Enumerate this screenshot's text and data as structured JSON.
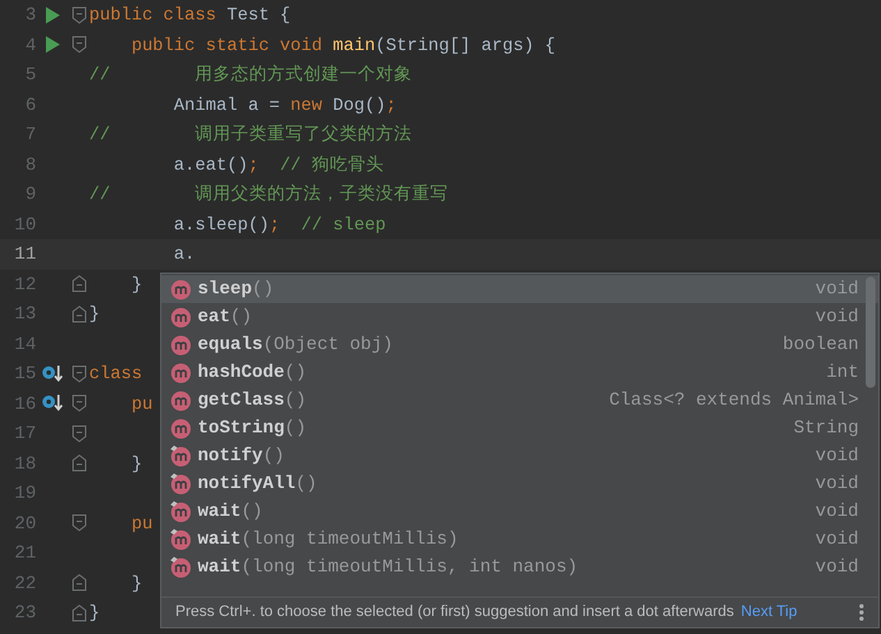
{
  "editor": {
    "lines": [
      {
        "number": "3",
        "runnable": true,
        "overridden": false,
        "fold_start": true,
        "fold_end": false,
        "current": false,
        "tokens": [
          {
            "kind": "keyword",
            "text": "public class "
          },
          {
            "kind": "plain",
            "text": "Test {"
          }
        ]
      },
      {
        "number": "4",
        "runnable": true,
        "overridden": false,
        "fold_start": true,
        "fold_end": false,
        "current": false,
        "tokens": [
          {
            "kind": "keyword",
            "text": "    public static void "
          },
          {
            "kind": "method",
            "text": "main"
          },
          {
            "kind": "plain",
            "text": "(String[] args) {"
          }
        ]
      },
      {
        "number": "5",
        "runnable": false,
        "overridden": false,
        "fold_start": false,
        "fold_end": false,
        "current": false,
        "tokens": [
          {
            "kind": "comment",
            "text": "//        用多态的方式创建一个对象"
          }
        ]
      },
      {
        "number": "6",
        "runnable": false,
        "overridden": false,
        "fold_start": false,
        "fold_end": false,
        "current": false,
        "tokens": [
          {
            "kind": "plain",
            "text": "        Animal a = "
          },
          {
            "kind": "keyword",
            "text": "new "
          },
          {
            "kind": "plain",
            "text": "Dog()"
          },
          {
            "kind": "keyword",
            "text": ";"
          }
        ]
      },
      {
        "number": "7",
        "runnable": false,
        "overridden": false,
        "fold_start": false,
        "fold_end": false,
        "current": false,
        "tokens": [
          {
            "kind": "comment",
            "text": "//        调用子类重写了父类的方法"
          }
        ]
      },
      {
        "number": "8",
        "runnable": false,
        "overridden": false,
        "fold_start": false,
        "fold_end": false,
        "current": false,
        "tokens": [
          {
            "kind": "plain",
            "text": "        a.eat()"
          },
          {
            "kind": "keyword",
            "text": ";  "
          },
          {
            "kind": "comment",
            "text": "// 狗吃骨头"
          }
        ]
      },
      {
        "number": "9",
        "runnable": false,
        "overridden": false,
        "fold_start": false,
        "fold_end": false,
        "current": false,
        "tokens": [
          {
            "kind": "comment",
            "text": "//        调用父类的方法，子类没有重写"
          }
        ]
      },
      {
        "number": "10",
        "runnable": false,
        "overridden": false,
        "fold_start": false,
        "fold_end": false,
        "current": false,
        "tokens": [
          {
            "kind": "plain",
            "text": "        a.sleep()"
          },
          {
            "kind": "keyword",
            "text": ";  "
          },
          {
            "kind": "comment",
            "text": "// sleep"
          }
        ]
      },
      {
        "number": "11",
        "runnable": false,
        "overridden": false,
        "fold_start": false,
        "fold_end": false,
        "current": true,
        "tokens": [
          {
            "kind": "plain",
            "text": "        a."
          }
        ]
      },
      {
        "number": "12",
        "runnable": false,
        "overridden": false,
        "fold_start": false,
        "fold_end": true,
        "current": false,
        "tokens": [
          {
            "kind": "plain",
            "text": "    }"
          }
        ]
      },
      {
        "number": "13",
        "runnable": false,
        "overridden": false,
        "fold_start": false,
        "fold_end": true,
        "current": false,
        "tokens": [
          {
            "kind": "plain",
            "text": "}"
          }
        ]
      },
      {
        "number": "14",
        "runnable": false,
        "overridden": false,
        "fold_start": false,
        "fold_end": false,
        "current": false
      },
      {
        "number": "15",
        "runnable": false,
        "overridden": true,
        "fold_start": true,
        "fold_end": false,
        "current": false,
        "tokens": [
          {
            "kind": "keyword",
            "text": "class"
          }
        ]
      },
      {
        "number": "16",
        "runnable": false,
        "overridden": true,
        "fold_start": true,
        "fold_end": false,
        "current": false,
        "tokens": [
          {
            "kind": "keyword",
            "text": "    pu"
          }
        ]
      },
      {
        "number": "17",
        "runnable": false,
        "overridden": false,
        "fold_start": true,
        "fold_end": false,
        "current": false
      },
      {
        "number": "18",
        "runnable": false,
        "overridden": false,
        "fold_start": false,
        "fold_end": true,
        "current": false,
        "tokens": [
          {
            "kind": "plain",
            "text": "    }"
          }
        ]
      },
      {
        "number": "19",
        "runnable": false,
        "overridden": false,
        "fold_start": false,
        "fold_end": false,
        "current": false
      },
      {
        "number": "20",
        "runnable": false,
        "overridden": false,
        "fold_start": true,
        "fold_end": false,
        "current": false,
        "tokens": [
          {
            "kind": "keyword",
            "text": "    pu"
          }
        ]
      },
      {
        "number": "21",
        "runnable": false,
        "overridden": false,
        "fold_start": false,
        "fold_end": false,
        "current": false
      },
      {
        "number": "22",
        "runnable": false,
        "overridden": false,
        "fold_start": false,
        "fold_end": true,
        "current": false,
        "tokens": [
          {
            "kind": "plain",
            "text": "    }"
          }
        ]
      },
      {
        "number": "23",
        "runnable": false,
        "overridden": false,
        "fold_start": false,
        "fold_end": true,
        "current": false,
        "tokens": [
          {
            "kind": "plain",
            "text": "}"
          }
        ]
      }
    ]
  },
  "completion_popup": {
    "items": [
      {
        "name": "sleep",
        "params": "()",
        "type": "void",
        "final": false,
        "selected": true
      },
      {
        "name": "eat",
        "params": "()",
        "type": "void",
        "final": false,
        "selected": false
      },
      {
        "name": "equals",
        "params": "(Object obj)",
        "type": "boolean",
        "final": false,
        "selected": false
      },
      {
        "name": "hashCode",
        "params": "()",
        "type": "int",
        "final": false,
        "selected": false
      },
      {
        "name": "getClass",
        "params": "()",
        "type": "Class<? extends Animal>",
        "final": false,
        "selected": false
      },
      {
        "name": "toString",
        "params": "()",
        "type": "String",
        "final": false,
        "selected": false
      },
      {
        "name": "notify",
        "params": "()",
        "type": "void",
        "final": true,
        "selected": false
      },
      {
        "name": "notifyAll",
        "params": "()",
        "type": "void",
        "final": true,
        "selected": false
      },
      {
        "name": "wait",
        "params": "()",
        "type": "void",
        "final": true,
        "selected": false
      },
      {
        "name": "wait",
        "params": "(long timeoutMillis)",
        "type": "void",
        "final": true,
        "selected": false
      },
      {
        "name": "wait",
        "params": "(long timeoutMillis, int nanos)",
        "type": "void",
        "final": true,
        "selected": false
      }
    ],
    "hint": "Press Ctrl+. to choose the selected (or first) suggestion and insert a dot afterwards",
    "hint_link": "Next Tip"
  }
}
